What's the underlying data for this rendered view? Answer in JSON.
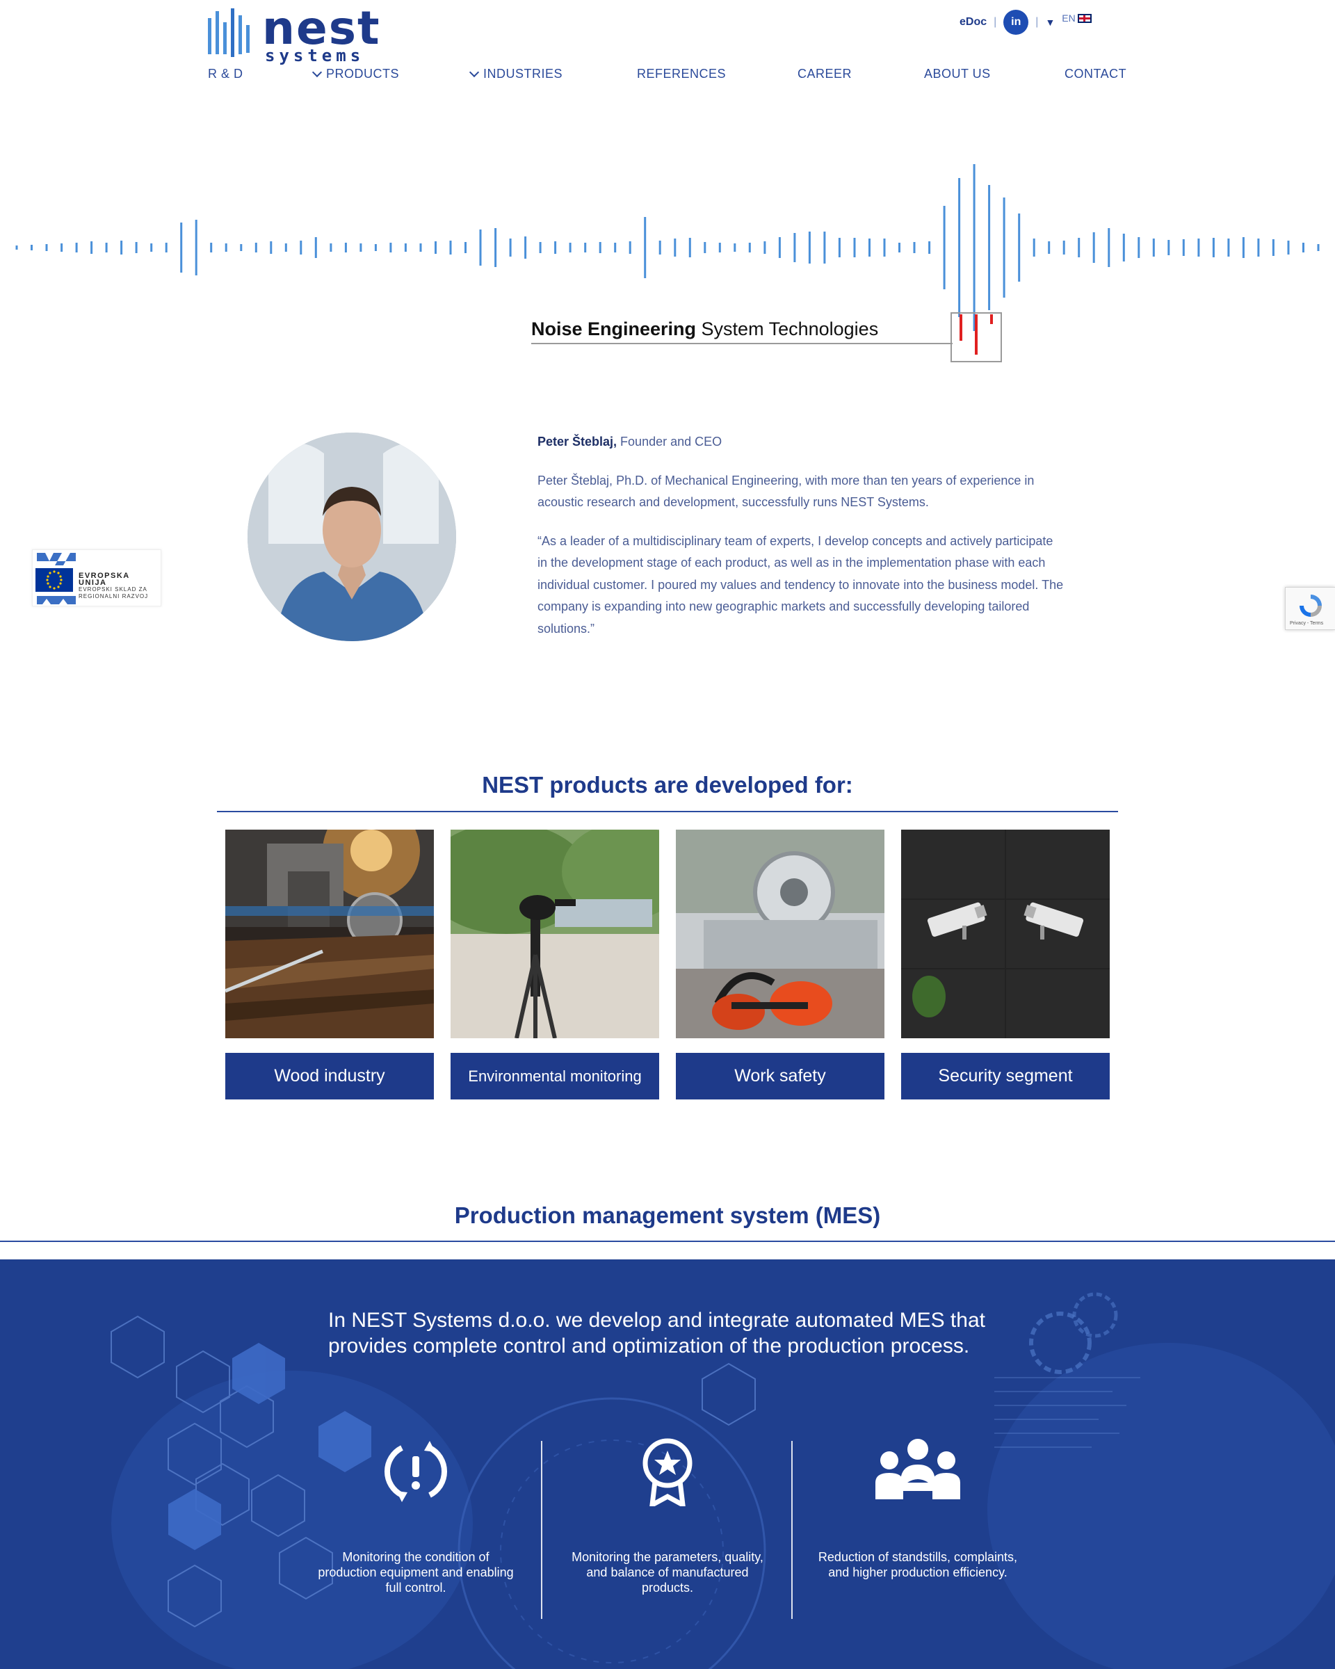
{
  "brand": {
    "name": "nest",
    "sub": "systems"
  },
  "topbar": {
    "edoc": "eDoc",
    "separator": "|",
    "linkedin": "in",
    "lang": "EN"
  },
  "nav": [
    {
      "label": "R & D",
      "dropdown": false
    },
    {
      "label": "PRODUCTS",
      "dropdown": true
    },
    {
      "label": "INDUSTRIES",
      "dropdown": true
    },
    {
      "label": "REFERENCES",
      "dropdown": false
    },
    {
      "label": "CAREER",
      "dropdown": false
    },
    {
      "label": "ABOUT US",
      "dropdown": false
    },
    {
      "label": "CONTACT",
      "dropdown": false
    }
  ],
  "hero": {
    "tagline_bold": "Noise Engineering",
    "tagline_rest": " System Technologies"
  },
  "eu_badge": {
    "line1": "EVROPSKA UNIJA",
    "line2": "EVROPSKI SKLAD ZA",
    "line3": "REGIONALNI RAZVOJ"
  },
  "recaptcha": {
    "text": "Privacy - Terms"
  },
  "founder": {
    "name": "Peter Šteblaj,",
    "role": " Founder and CEO",
    "bio": "Peter Šteblaj, Ph.D. of Mechanical Engineering, with more than ten years of experience in acoustic research and development, successfully runs NEST Systems.",
    "quote": "“As a leader of a multidisciplinary team of experts, I develop concepts and actively participate in the development stage of each product, as well as in the implementation phase with each individual customer. I poured my values and tendency to innovate into the business model. The company is expanding into new geographic markets and successfully developing tailored solutions.”"
  },
  "products": {
    "title": "NEST products are developed for:",
    "cards": [
      {
        "label": "Wood industry"
      },
      {
        "label": "Environmental monitoring"
      },
      {
        "label": "Work safety"
      },
      {
        "label": "Security segment"
      }
    ]
  },
  "mes": {
    "title": "Production management system (MES)",
    "intro": "In NEST Systems d.o.o. we develop and integrate automated MES that provides complete control and optimization of the production process.",
    "features": [
      {
        "icon": "alert-cycle-icon",
        "text": "Monitoring the condition of production equipment and enabling full control."
      },
      {
        "icon": "award-badge-icon",
        "text": "Monitoring the parameters, quality, and balance of manufactured products."
      },
      {
        "icon": "team-icon",
        "text": "Reduction of standstills, complaints, and higher production efficiency."
      }
    ]
  },
  "colors": {
    "brand_blue": "#1e3a8a",
    "wave_blue": "#4a90d9",
    "accent_red": "#e02020"
  }
}
